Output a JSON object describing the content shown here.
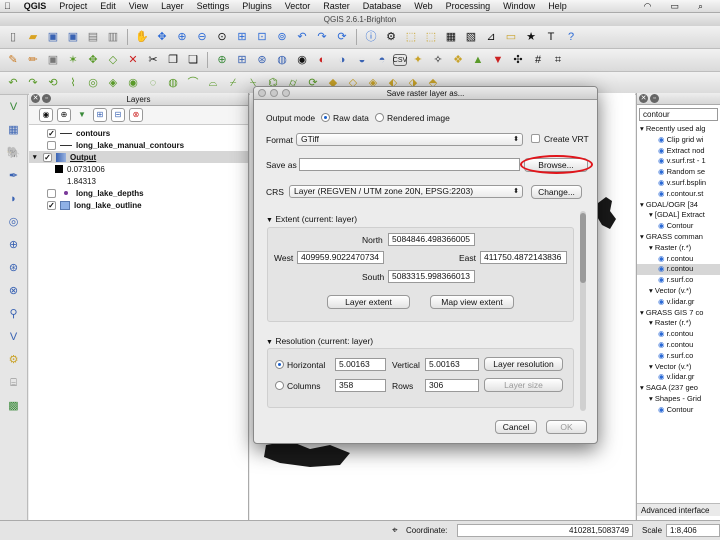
{
  "menubar": {
    "apple": "",
    "app": "QGIS",
    "items": [
      "Project",
      "Edit",
      "View",
      "Layer",
      "Settings",
      "Plugins",
      "Vector",
      "Raster",
      "Database",
      "Web",
      "Processing",
      "Window",
      "Help"
    ]
  },
  "window": {
    "title": "QGIS 2.6.1-Brighton"
  },
  "layers_panel": {
    "title": "Layers",
    "items": [
      {
        "name": "contours",
        "checked": true
      },
      {
        "name": "long_lake_manual_contours",
        "checked": false
      },
      {
        "name": "Output",
        "checked": true,
        "selected": true
      },
      {
        "name": "0.0731006",
        "legend": true
      },
      {
        "name": "1.84313",
        "legend": true
      },
      {
        "name": "long_lake_depths",
        "checked": false
      },
      {
        "name": "long_lake_outline",
        "checked": true
      }
    ]
  },
  "processing_panel": {
    "search": "contour",
    "items": [
      {
        "label": "Recently used alg",
        "indent": 0,
        "arrow": "▾"
      },
      {
        "label": "Clip grid wi",
        "indent": 2
      },
      {
        "label": "Extract nod",
        "indent": 2
      },
      {
        "label": "v.surf.rst - 1",
        "indent": 2
      },
      {
        "label": "Random se",
        "indent": 2
      },
      {
        "label": "v.surf.bsplin",
        "indent": 2
      },
      {
        "label": "r.contour.st",
        "indent": 2
      },
      {
        "label": "GDAL/OGR [34",
        "indent": 0,
        "arrow": "▾"
      },
      {
        "label": "[GDAL] Extract",
        "indent": 1,
        "arrow": "▾"
      },
      {
        "label": "Contour",
        "indent": 2
      },
      {
        "label": "GRASS comman",
        "indent": 0,
        "arrow": "▾"
      },
      {
        "label": "Raster (r.*)",
        "indent": 1,
        "arrow": "▾"
      },
      {
        "label": "r.contou",
        "indent": 2
      },
      {
        "label": "r.contou",
        "indent": 2,
        "selected": true
      },
      {
        "label": "r.surf.co",
        "indent": 2
      },
      {
        "label": "Vector (v.*)",
        "indent": 1,
        "arrow": "▾"
      },
      {
        "label": "v.lidar.gr",
        "indent": 2
      },
      {
        "label": "GRASS GIS 7 co",
        "indent": 0,
        "arrow": "▾"
      },
      {
        "label": "Raster (r.*)",
        "indent": 1,
        "arrow": "▾"
      },
      {
        "label": "r.contou",
        "indent": 2
      },
      {
        "label": "r.contou",
        "indent": 2
      },
      {
        "label": "r.surf.co",
        "indent": 2
      },
      {
        "label": "Vector (v.*)",
        "indent": 1,
        "arrow": "▾"
      },
      {
        "label": "v.lidar.gr",
        "indent": 2
      },
      {
        "label": "SAGA (237 geo",
        "indent": 0,
        "arrow": "▾"
      },
      {
        "label": "Shapes - Grid",
        "indent": 1,
        "arrow": "▾"
      },
      {
        "label": "Contour",
        "indent": 2
      }
    ],
    "advanced": "Advanced interface"
  },
  "statusbar": {
    "coordinate_label": "Coordinate:",
    "coordinate_value": "410281,5083749",
    "scale_label": "Scale",
    "scale_value": "1:8,406"
  },
  "dialog": {
    "title": "Save raster layer as...",
    "output_mode_label": "Output mode",
    "raw_data": "Raw data",
    "rendered_image": "Rendered image",
    "format_label": "Format",
    "format_value": "GTiff",
    "create_vrt": "Create VRT",
    "save_as_label": "Save as",
    "save_as_value": "",
    "browse": "Browse...",
    "crs_label": "CRS",
    "crs_value": "Layer (REGVEN / UTM zone 20N, EPSG:2203)",
    "change": "Change...",
    "extent_title": "Extent (current: layer)",
    "north_label": "North",
    "north_value": "5084846.498366005",
    "west_label": "West",
    "west_value": "409959.9022470734",
    "east_label": "East",
    "east_value": "411750.4872143836",
    "south_label": "South",
    "south_value": "5083315.998366013",
    "layer_extent": "Layer extent",
    "map_view_extent": "Map view extent",
    "resolution_title": "Resolution (current: layer)",
    "horizontal_label": "Horizontal",
    "horizontal_value": "5.00163",
    "vertical_label": "Vertical",
    "vertical_value": "5.00163",
    "layer_resolution": "Layer resolution",
    "columns_label": "Columns",
    "columns_value": "358",
    "rows_label": "Rows",
    "rows_value": "306",
    "layer_size": "Layer size",
    "cancel": "Cancel",
    "ok": "OK"
  },
  "colors": {
    "highlight_ring": "#e0151b",
    "selection": "#1a5fcb"
  }
}
